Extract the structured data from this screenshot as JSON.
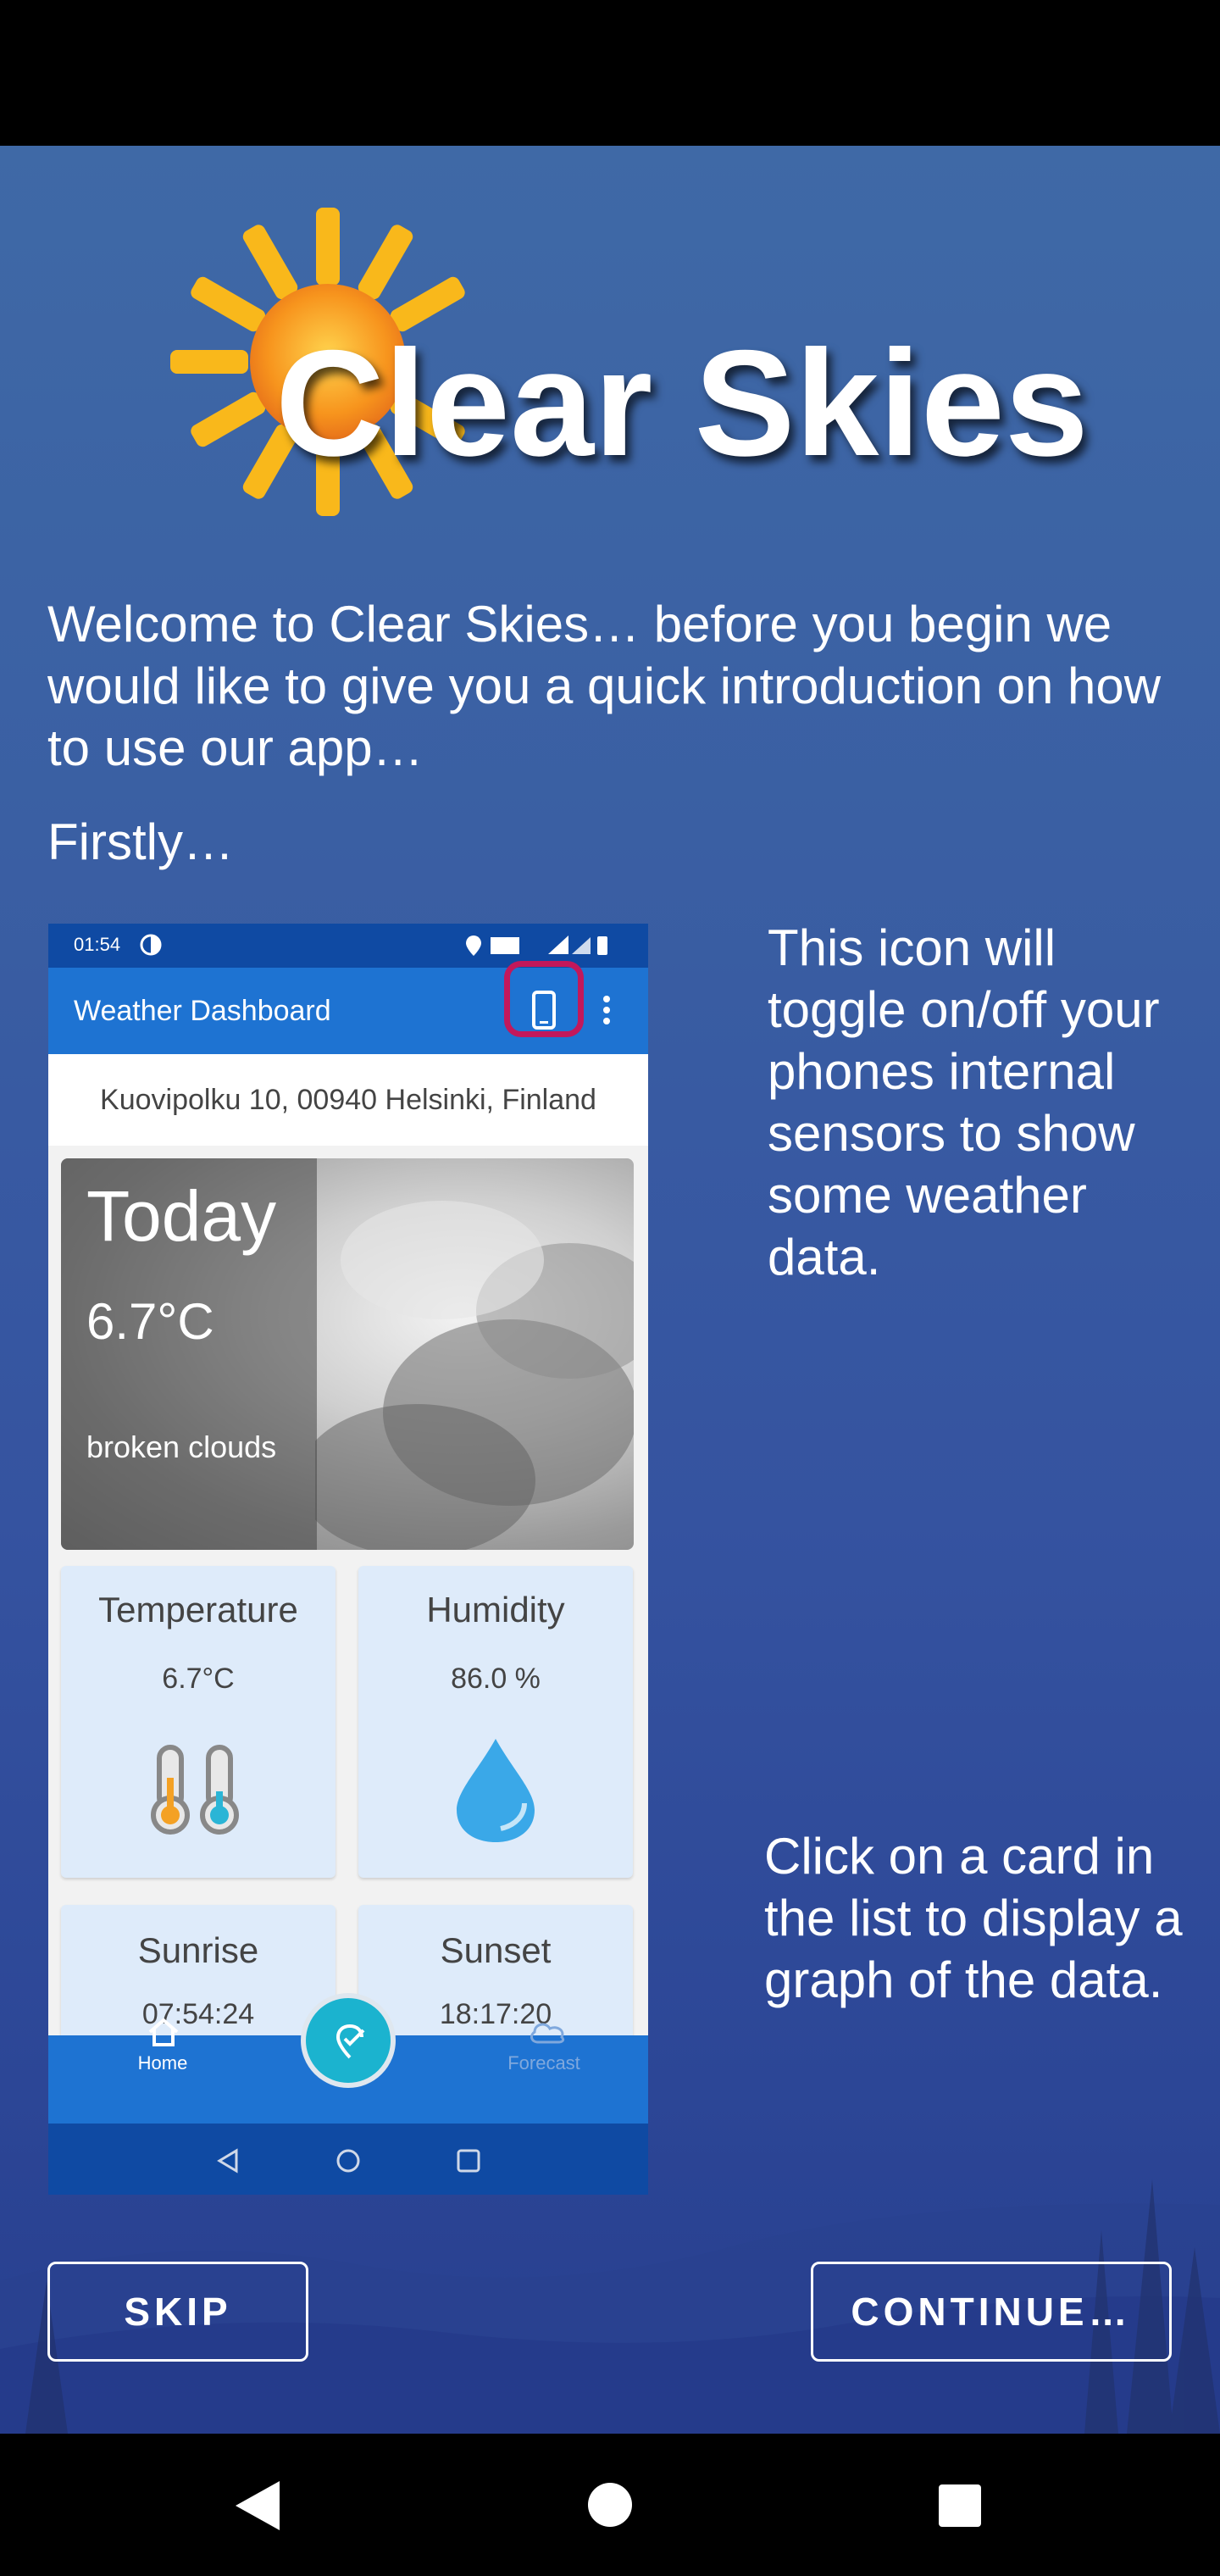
{
  "logo": {
    "text": "Clear Skies"
  },
  "intro": {
    "welcome": "Welcome to Clear Skies… before you begin we would like to give you a quick introduction on how to use our app…",
    "firstly": "Firstly…"
  },
  "hints": {
    "sensor_icon": "This icon will toggle on/off your phones internal sensors to show some weather data.",
    "card_click": "Click on a card in the list to display a graph of the data."
  },
  "mockup": {
    "status_time": "01:54",
    "app_title": "Weather Dashboard",
    "address": "Kuovipolku 10, 00940 Helsinki, Finland",
    "today": {
      "title": "Today",
      "temperature": "6.7°C",
      "description": "broken clouds"
    },
    "cards": {
      "temperature": {
        "label": "Temperature",
        "value": "6.7°C"
      },
      "humidity": {
        "label": "Humidity",
        "value": "86.0 %"
      },
      "sunrise": {
        "label": "Sunrise",
        "value": "07:54:24"
      },
      "sunset": {
        "label": "Sunset",
        "value": "18:17:20"
      }
    },
    "nav": {
      "home": "Home",
      "forecast": "Forecast"
    }
  },
  "buttons": {
    "skip": "SKIP",
    "continue": "CONTINUE…"
  },
  "colors": {
    "accent_highlight": "#c2185b",
    "app_bar": "#1e73d2",
    "fab": "#1bb3cf",
    "sun": "#f7a21b"
  }
}
